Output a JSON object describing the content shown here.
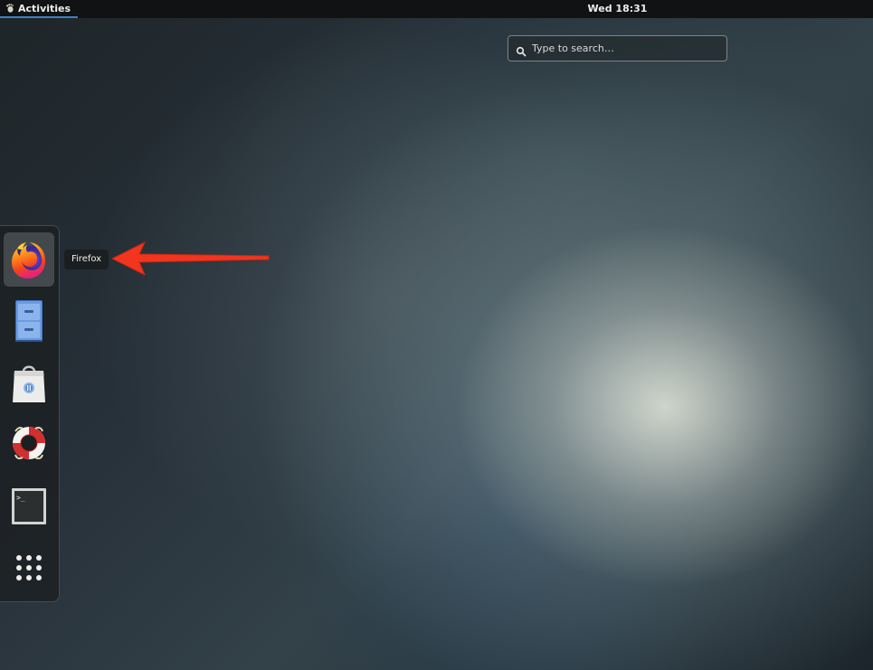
{
  "topbar": {
    "activities_label": "Activities",
    "activities_icon": "gnome-foot-icon",
    "clock": "Wed 18:31"
  },
  "search": {
    "placeholder": "Type to search…",
    "value": ""
  },
  "dash": {
    "items": [
      {
        "name": "firefox",
        "icon": "firefox-icon",
        "active": true
      },
      {
        "name": "files",
        "icon": "file-cabinet-icon",
        "active": false
      },
      {
        "name": "software",
        "icon": "shopping-bag-icon",
        "active": false
      },
      {
        "name": "help",
        "icon": "lifebuoy-icon",
        "active": false
      },
      {
        "name": "terminal",
        "icon": "terminal-icon",
        "active": false
      },
      {
        "name": "show-applications",
        "icon": "app-grid-icon",
        "active": false
      }
    ]
  },
  "tooltip": {
    "label": "Firefox"
  },
  "annotation": {
    "arrow_color": "#f2351f"
  },
  "colors": {
    "topbar": "#101214",
    "accent": "#3f7fc8"
  }
}
